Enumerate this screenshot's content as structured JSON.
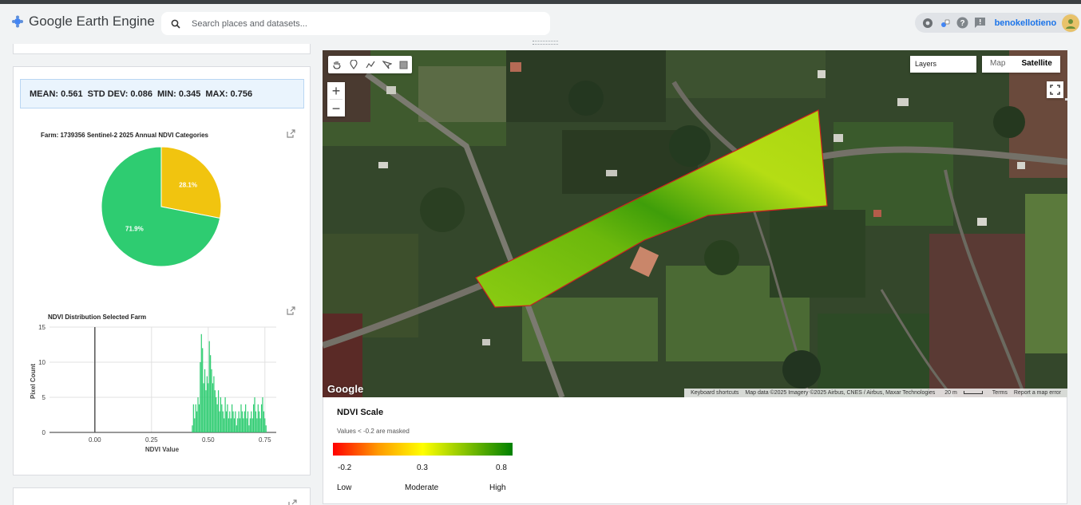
{
  "header": {
    "app_title": "Google Earth Engine",
    "search_placeholder": "Search places and datasets...",
    "username": "benokellotieno"
  },
  "stats": {
    "mean": "MEAN: 0.561",
    "std": "STD DEV: 0.086",
    "min": "MIN: 0.345",
    "max": "MAX: 0.756"
  },
  "chart_data": [
    {
      "type": "pie",
      "title": "Farm: 1739356 Sentinel-2 2025 Annual NDVI Categories",
      "slices": [
        {
          "label": "28.1%",
          "value": 28.1,
          "color": "#f1c40f"
        },
        {
          "label": "71.9%",
          "value": 71.9,
          "color": "#2ecc71"
        }
      ]
    },
    {
      "type": "bar",
      "title": "NDVI Distribution Selected Farm",
      "xlabel": "NDVI Value",
      "ylabel": "Pixel Count",
      "xlim": [
        -0.2,
        0.8
      ],
      "ylim": [
        0,
        15
      ],
      "xticks": [
        "0.00",
        "0.25",
        "0.50",
        "0.75"
      ],
      "yticks": [
        "0",
        "5",
        "10",
        "15"
      ],
      "color": "#2ecc71",
      "bins": [
        {
          "x": 0.0,
          "y": 15
        },
        {
          "x": 0.43,
          "y": 1
        },
        {
          "x": 0.435,
          "y": 4
        },
        {
          "x": 0.44,
          "y": 2
        },
        {
          "x": 0.445,
          "y": 4
        },
        {
          "x": 0.45,
          "y": 3
        },
        {
          "x": 0.455,
          "y": 5
        },
        {
          "x": 0.46,
          "y": 4
        },
        {
          "x": 0.465,
          "y": 10
        },
        {
          "x": 0.47,
          "y": 14
        },
        {
          "x": 0.475,
          "y": 12
        },
        {
          "x": 0.48,
          "y": 7
        },
        {
          "x": 0.485,
          "y": 9
        },
        {
          "x": 0.49,
          "y": 6
        },
        {
          "x": 0.495,
          "y": 8
        },
        {
          "x": 0.5,
          "y": 7
        },
        {
          "x": 0.505,
          "y": 13
        },
        {
          "x": 0.51,
          "y": 11
        },
        {
          "x": 0.515,
          "y": 9
        },
        {
          "x": 0.52,
          "y": 7
        },
        {
          "x": 0.525,
          "y": 8
        },
        {
          "x": 0.53,
          "y": 6
        },
        {
          "x": 0.535,
          "y": 5
        },
        {
          "x": 0.54,
          "y": 4
        },
        {
          "x": 0.545,
          "y": 6
        },
        {
          "x": 0.55,
          "y": 3
        },
        {
          "x": 0.555,
          "y": 5
        },
        {
          "x": 0.56,
          "y": 4
        },
        {
          "x": 0.565,
          "y": 3
        },
        {
          "x": 0.57,
          "y": 2
        },
        {
          "x": 0.575,
          "y": 5
        },
        {
          "x": 0.58,
          "y": 3
        },
        {
          "x": 0.585,
          "y": 4
        },
        {
          "x": 0.59,
          "y": 2
        },
        {
          "x": 0.595,
          "y": 3
        },
        {
          "x": 0.6,
          "y": 2
        },
        {
          "x": 0.605,
          "y": 4
        },
        {
          "x": 0.61,
          "y": 3
        },
        {
          "x": 0.615,
          "y": 2
        },
        {
          "x": 0.62,
          "y": 3
        },
        {
          "x": 0.625,
          "y": 1
        },
        {
          "x": 0.63,
          "y": 2
        },
        {
          "x": 0.635,
          "y": 3
        },
        {
          "x": 0.64,
          "y": 2
        },
        {
          "x": 0.645,
          "y": 4
        },
        {
          "x": 0.65,
          "y": 3
        },
        {
          "x": 0.655,
          "y": 2
        },
        {
          "x": 0.66,
          "y": 3
        },
        {
          "x": 0.665,
          "y": 4
        },
        {
          "x": 0.67,
          "y": 2
        },
        {
          "x": 0.675,
          "y": 3
        },
        {
          "x": 0.68,
          "y": 1
        },
        {
          "x": 0.685,
          "y": 2
        },
        {
          "x": 0.69,
          "y": 3
        },
        {
          "x": 0.695,
          "y": 2
        },
        {
          "x": 0.7,
          "y": 4
        },
        {
          "x": 0.705,
          "y": 5
        },
        {
          "x": 0.71,
          "y": 3
        },
        {
          "x": 0.715,
          "y": 2
        },
        {
          "x": 0.72,
          "y": 4
        },
        {
          "x": 0.725,
          "y": 3
        },
        {
          "x": 0.73,
          "y": 2
        },
        {
          "x": 0.735,
          "y": 4
        },
        {
          "x": 0.74,
          "y": 5
        },
        {
          "x": 0.745,
          "y": 3
        },
        {
          "x": 0.75,
          "y": 2
        },
        {
          "x": 0.755,
          "y": 1
        }
      ]
    }
  ],
  "map": {
    "layers_label": "Layers",
    "map_button": "Map",
    "satellite_button": "Satellite",
    "zoom_in": "+",
    "zoom_out": "−",
    "google_logo": "Google",
    "attribution": {
      "shortcuts": "Keyboard shortcuts",
      "data": "Map data ©2025 Imagery ©2025 Airbus, CNES / Airbus, Maxar Technologies",
      "scale": "20 m",
      "terms": "Terms",
      "report": "Report a map error"
    }
  },
  "legend": {
    "title": "NDVI Scale",
    "note": "Values < -0.2 are masked",
    "numbers": [
      "-0.2",
      "0.3",
      "0.8"
    ],
    "words": [
      "Low",
      "Moderate",
      "High"
    ]
  }
}
